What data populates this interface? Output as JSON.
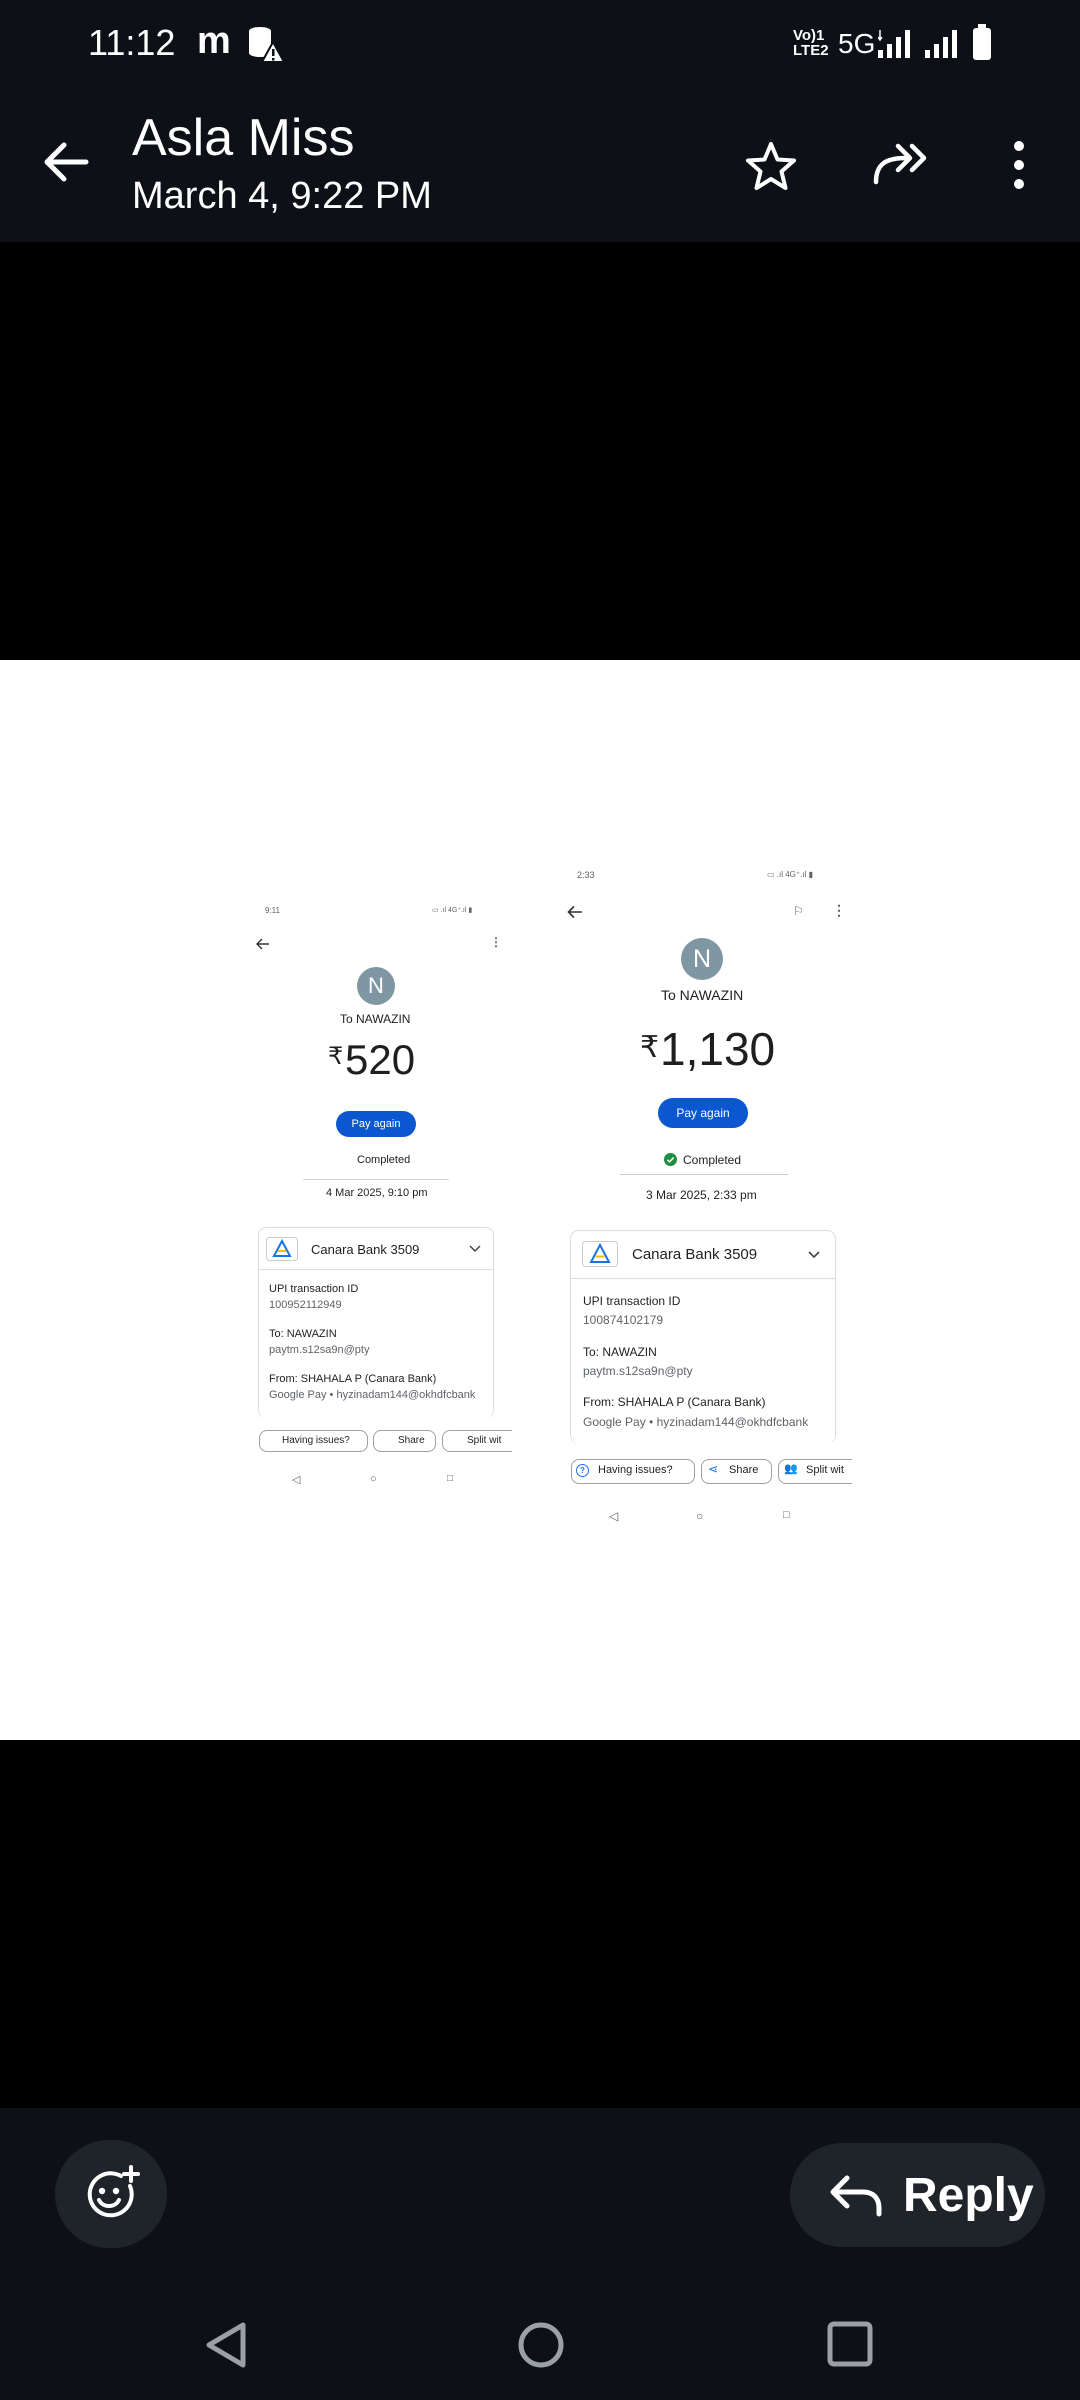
{
  "status_bar": {
    "time": "11:12",
    "network": "5G",
    "volte": "VoLTE2",
    "carrier_icon": "m"
  },
  "header": {
    "title": "Asla Miss",
    "subtitle": "March 4, 9:22 PM"
  },
  "left_shot": {
    "time": "9:11",
    "avatar": "N",
    "to": "To NAWAZIN",
    "currency": "₹",
    "amount": "520",
    "pay_again": "Pay again",
    "status": "Completed",
    "date": "4 Mar 2025, 9:10 pm",
    "bank": "Canara Bank 3509",
    "upi_label": "UPI transaction ID",
    "upi_id": "100952112949",
    "to_label": "To: NAWAZIN",
    "to_handle": "paytm.s12sa9n@pty",
    "from_label": "From: SHAHALA P (Canara Bank)",
    "from_handle": "Google Pay • hyzinadam144@okhdfcbank",
    "actions": [
      "Having issues?",
      "Share",
      "Split wit"
    ]
  },
  "right_shot": {
    "time": "2:33",
    "avatar": "N",
    "to": "To NAWAZIN",
    "currency": "₹",
    "amount": "1,130",
    "pay_again": "Pay again",
    "status": "Completed",
    "date": "3 Mar 2025, 2:33 pm",
    "bank": "Canara Bank 3509",
    "upi_label": "UPI transaction ID",
    "upi_id": "100874102179",
    "to_label": "To: NAWAZIN",
    "to_handle": "paytm.s12sa9n@pty",
    "from_label": "From: SHAHALA P (Canara Bank)",
    "from_handle": "Google Pay • hyzinadam144@okhdfcbank",
    "actions": [
      "Having issues?",
      "Share",
      "Split wit"
    ]
  },
  "footer": {
    "reply_label": "Reply"
  },
  "colors": {
    "bar_bg": "#0d1117",
    "pay_blue": "#0b57d0",
    "avatar_gray": "#7f97a2",
    "success_green": "#1e8e3e"
  }
}
